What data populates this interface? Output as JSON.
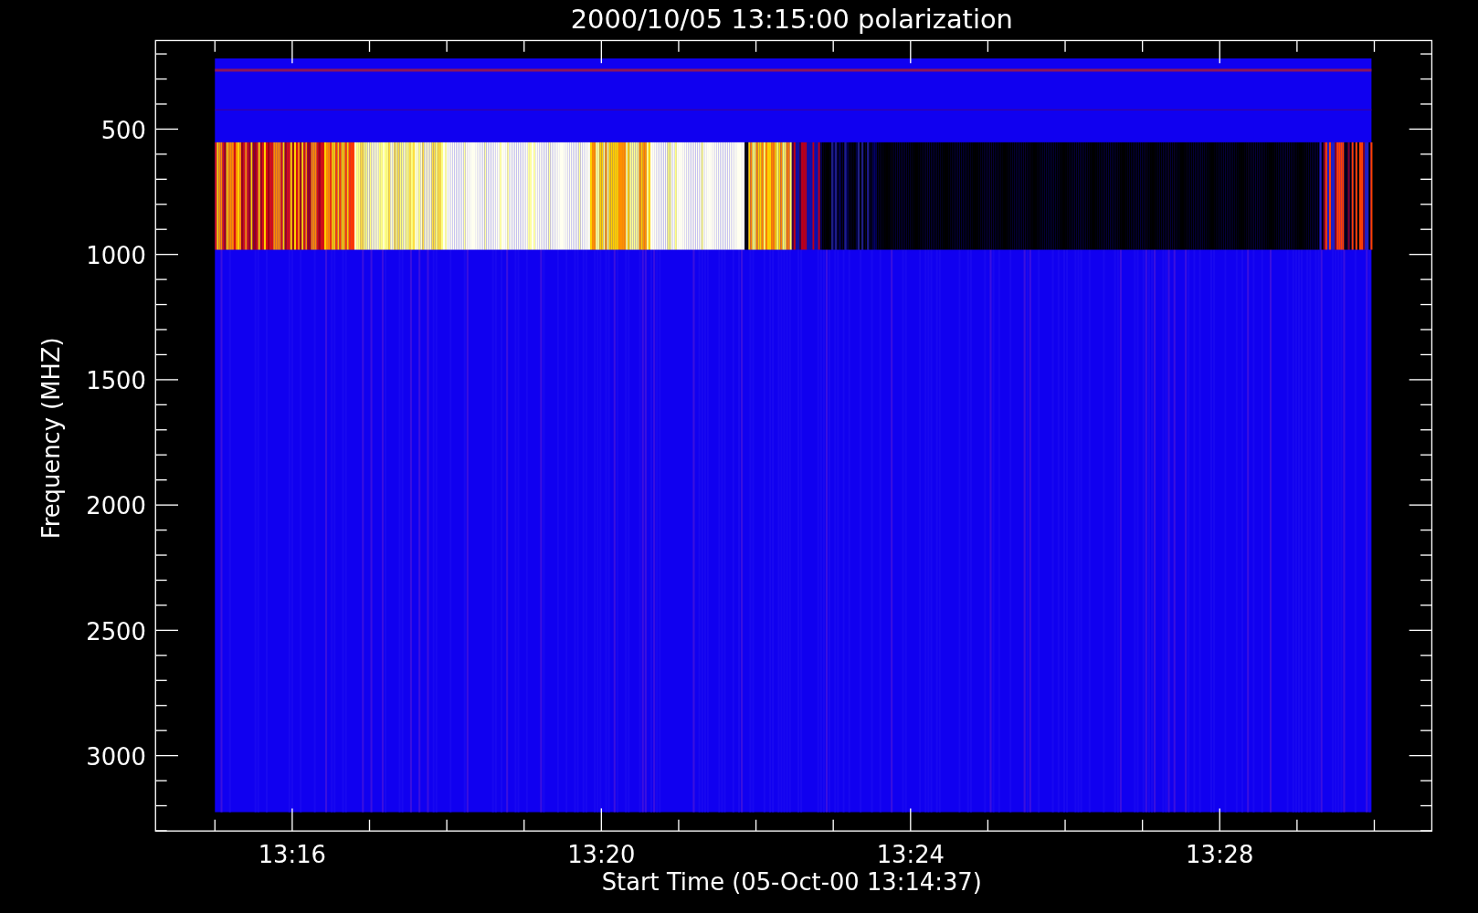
{
  "plot": {
    "title": "2000/10/05 13:15:00 polarization",
    "ylabel": "Frequency (MHZ)",
    "xlabel": "Start Time (05-Oct-00 13:14:37)",
    "yticks": [
      "500",
      "1000",
      "1500",
      "2000",
      "2500",
      "3000"
    ],
    "xticks": [
      "13:16",
      "13:20",
      "13:24",
      "13:28"
    ]
  }
}
